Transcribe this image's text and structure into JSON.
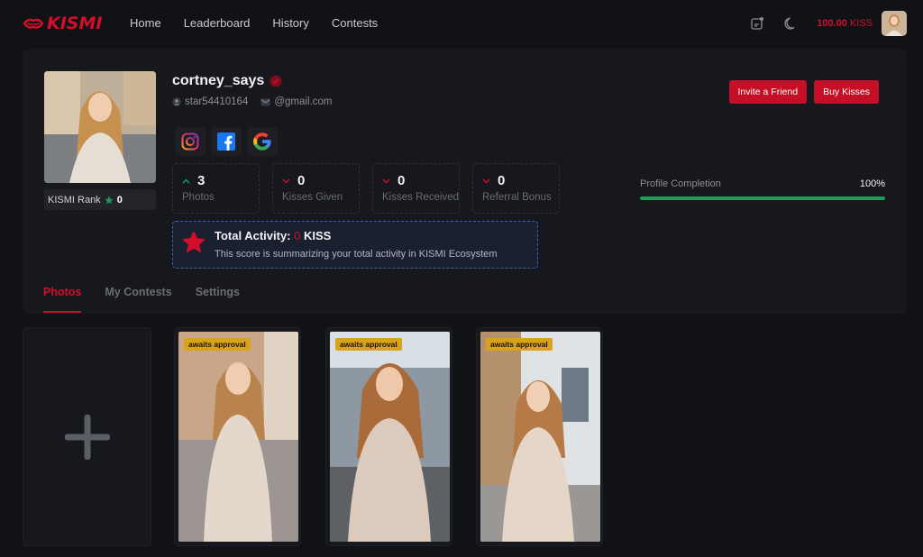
{
  "header": {
    "logo_text": "KISMI",
    "nav": [
      "Home",
      "Leaderboard",
      "History",
      "Contests"
    ],
    "balance_value": "100.00",
    "balance_unit": "KISS"
  },
  "profile": {
    "username": "cortney_says",
    "user_id": "star54410164",
    "email": "@gmail.com",
    "rank_label": "KISMI Rank",
    "rank_value": "0",
    "invite_label": "Invite a Friend",
    "buy_label": "Buy Kisses",
    "stats": [
      {
        "value": "3",
        "label": "Photos",
        "trend": "up"
      },
      {
        "value": "0",
        "label": "Kisses Given",
        "trend": "down"
      },
      {
        "value": "0",
        "label": "Kisses Received",
        "trend": "down"
      },
      {
        "value": "0",
        "label": "Referral Bonus",
        "trend": "down"
      }
    ],
    "total_activity": {
      "label": "Total Activity:",
      "value": "0",
      "unit": "KISS",
      "description": "This score is summarizing your total activity in KISMI Ecosystem"
    },
    "completion": {
      "label": "Profile Completion",
      "value_text": "100%",
      "fraction": 1.0
    }
  },
  "tabs": [
    "Photos",
    "My Contests",
    "Settings"
  ],
  "photos": [
    {
      "badge": "awaits approval"
    },
    {
      "badge": "awaits approval"
    },
    {
      "badge": "awaits approval"
    }
  ],
  "colors": {
    "accent": "#d10f2a",
    "success": "#1f9d56",
    "badge": "#d9a21a"
  }
}
